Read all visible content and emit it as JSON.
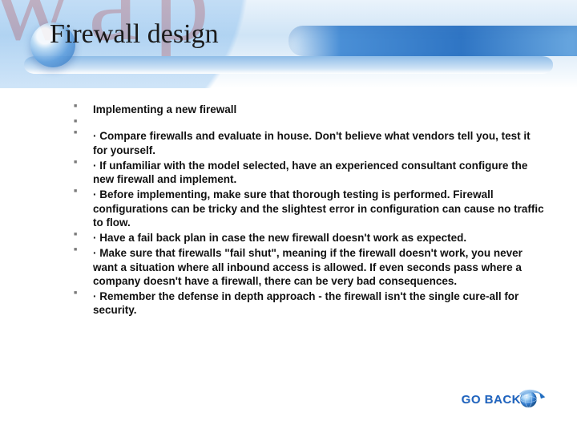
{
  "title": "Firewall design",
  "bullets": [
    "Implementing a new firewall",
    "",
    "·  Compare firewalls and evaluate in house. Don't believe what vendors tell you, test it for yourself.",
    "·  If unfamiliar with the model selected, have an experienced consultant configure the new firewall and implement.",
    "·  Before implementing, make sure that thorough testing is performed. Firewall configurations can be tricky and the slightest error in configuration can cause no traffic to flow.",
    "·  Have a fail back plan in case the new firewall doesn't work as expected.",
    "·  Make sure that firewalls \"fail shut\", meaning if the firewall doesn't work, you never want a situation where all inbound access is allowed. If even seconds pass where a company doesn't have a firewall, there can be very bad consequences.",
    "·  Remember the defense in depth approach - the firewall isn't the single cure-all for security."
  ],
  "goback_label": "GO BACK"
}
